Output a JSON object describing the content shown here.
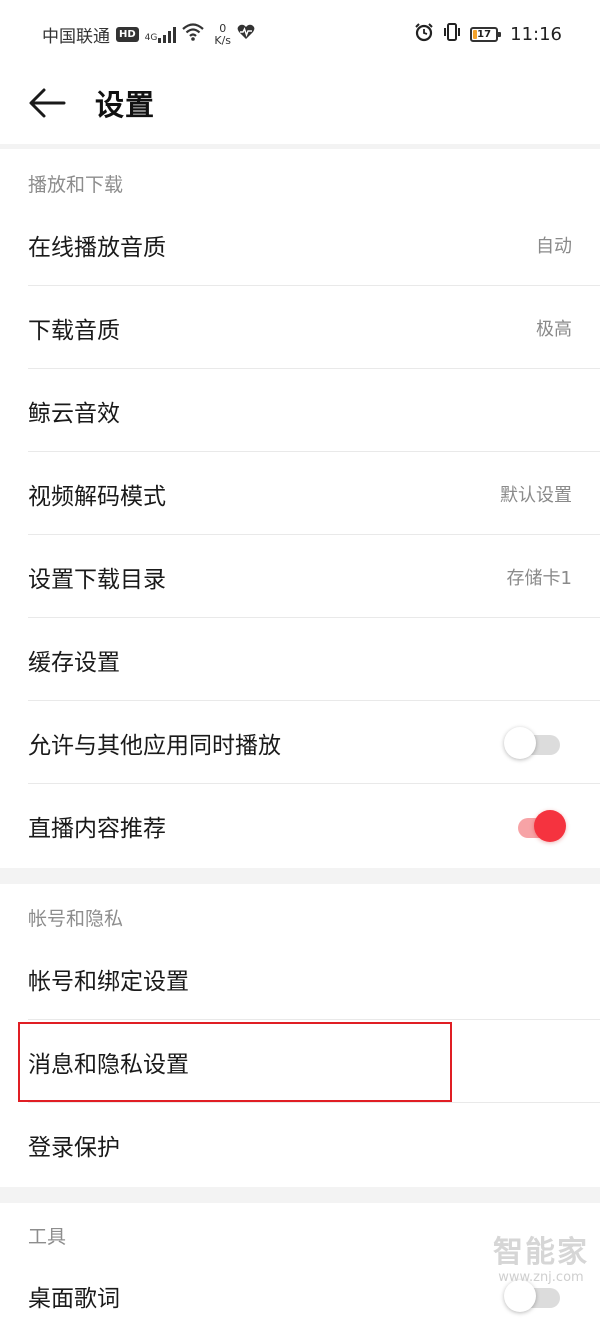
{
  "status_bar": {
    "carrier": "中国联通",
    "hd_badge": "HD",
    "network": "4G",
    "speed_value": "0",
    "speed_unit": "K/s",
    "battery_level": "17",
    "time": "11:16",
    "icons": [
      "signal-icon",
      "wifi-icon",
      "heartbeat-icon",
      "alarm-icon",
      "vibrate-icon",
      "battery-icon"
    ]
  },
  "header": {
    "title": "设置",
    "back_icon": "arrow-left-icon"
  },
  "sections": {
    "playback": {
      "title": "播放和下载",
      "items": [
        {
          "label": "在线播放音质",
          "value": "自动"
        },
        {
          "label": "下载音质",
          "value": "极高"
        },
        {
          "label": "鲸云音效",
          "value": ""
        },
        {
          "label": "视频解码模式",
          "value": "默认设置"
        },
        {
          "label": "设置下载目录",
          "value": "存储卡1"
        },
        {
          "label": "缓存设置",
          "value": ""
        },
        {
          "label": "允许与其他应用同时播放",
          "toggle": false
        },
        {
          "label": "直播内容推荐",
          "toggle": true
        }
      ]
    },
    "account": {
      "title": "帐号和隐私",
      "items": [
        {
          "label": "帐号和绑定设置"
        },
        {
          "label": "消息和隐私设置",
          "highlighted": true
        },
        {
          "label": "登录保护"
        }
      ]
    },
    "tools": {
      "title": "工具",
      "items": [
        {
          "label": "桌面歌词",
          "toggle": false
        }
      ]
    }
  },
  "colors": {
    "accent": "#f5333f",
    "highlight_border": "#e01e24",
    "section_gap": "#f3f3f3",
    "secondary_text": "#8a8a8a"
  },
  "watermark": {
    "text": "智能家",
    "url": "www.znj.com"
  }
}
